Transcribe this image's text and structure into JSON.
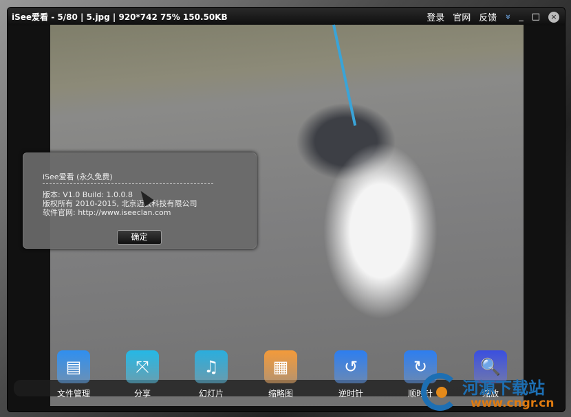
{
  "titlebar": {
    "title": "iSee爱看 - 5/80 | 5.jpg | 920*742 75% 150.50KB",
    "login": "登录",
    "website": "官网",
    "feedback": "反馈",
    "menu_icon": "»",
    "minimize": "_",
    "maximize": "□",
    "close": "×"
  },
  "dialog": {
    "title": "iSee爱看 (永久免费)",
    "version": "版本: V1.0   Build: 1.0.0.8",
    "copyright": "版权所有 2010-2015, 北京迈云科技有限公司",
    "site": "软件官网: http://www.iseeclan.com",
    "ok": "确定"
  },
  "toolbar": [
    {
      "label": "文件管理",
      "icon": "folder-icon",
      "glyph": "▤",
      "color": "#2f8ff0"
    },
    {
      "label": "分享",
      "icon": "share-icon",
      "glyph": "⤧",
      "color": "#25b8e6"
    },
    {
      "label": "幻灯片",
      "icon": "slideshow-icon",
      "glyph": "♫",
      "color": "#2aaede"
    },
    {
      "label": "缩略图",
      "icon": "thumbnails-icon",
      "glyph": "▦",
      "color": "#f39a3a"
    },
    {
      "label": "逆时针",
      "icon": "rotate-ccw-icon",
      "glyph": "↺",
      "color": "#2d7ef0"
    },
    {
      "label": "顺时针",
      "icon": "rotate-cw-icon",
      "glyph": "↻",
      "color": "#2d7ef0"
    },
    {
      "label": "缩放",
      "icon": "zoom-icon",
      "glyph": "🔍",
      "color": "#3a4fe0"
    }
  ],
  "watermark": {
    "name": "河源下载站",
    "url": "www.cngr.cn"
  }
}
